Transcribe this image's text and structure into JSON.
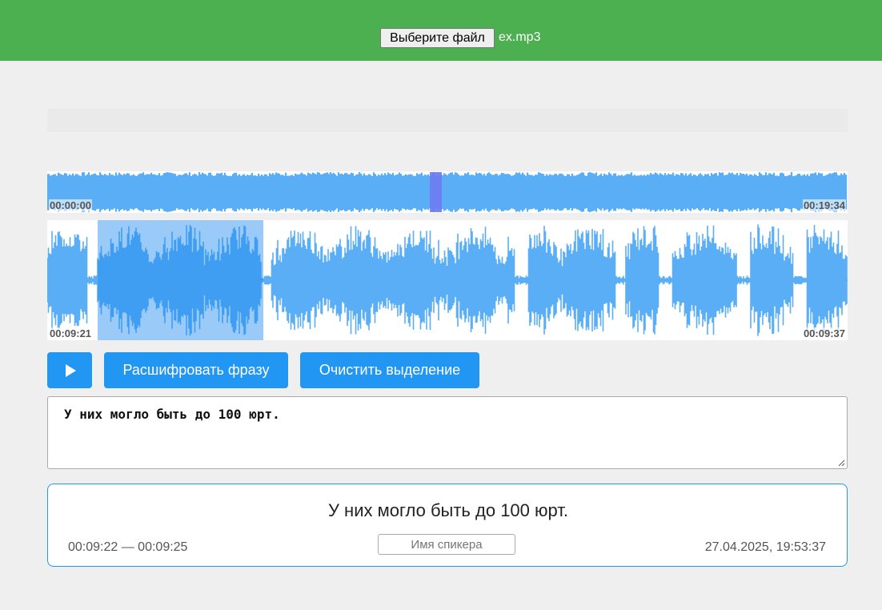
{
  "header": {
    "file_button_label": "Выберите файл",
    "file_name": "ex.mp3"
  },
  "overview": {
    "start_time": "00:00:00",
    "end_time": "00:19:34",
    "cursor_position_fraction": 0.485
  },
  "detail": {
    "start_time": "00:09:21",
    "end_time": "00:09:37",
    "selection_start_fraction": 0.063,
    "selection_end_fraction": 0.27
  },
  "controls": {
    "play_icon": "play-icon",
    "decode_label": "Расшифровать фразу",
    "clear_label": "Очистить выделение"
  },
  "transcript": {
    "value": "У них могло быть до 100 юрт."
  },
  "result_card": {
    "text": "У них могло быть до 100 юрт.",
    "time_range": "00:09:22 — 00:09:25",
    "speaker_placeholder": "Имя спикера",
    "timestamp": "27.04.2025, 19:53:37"
  },
  "colors": {
    "header_bg": "#4caf50",
    "accent": "#2196f3",
    "waveform": "#5aaef5",
    "selection": "#1e8cf0",
    "cursor": "#6c7cf0"
  }
}
